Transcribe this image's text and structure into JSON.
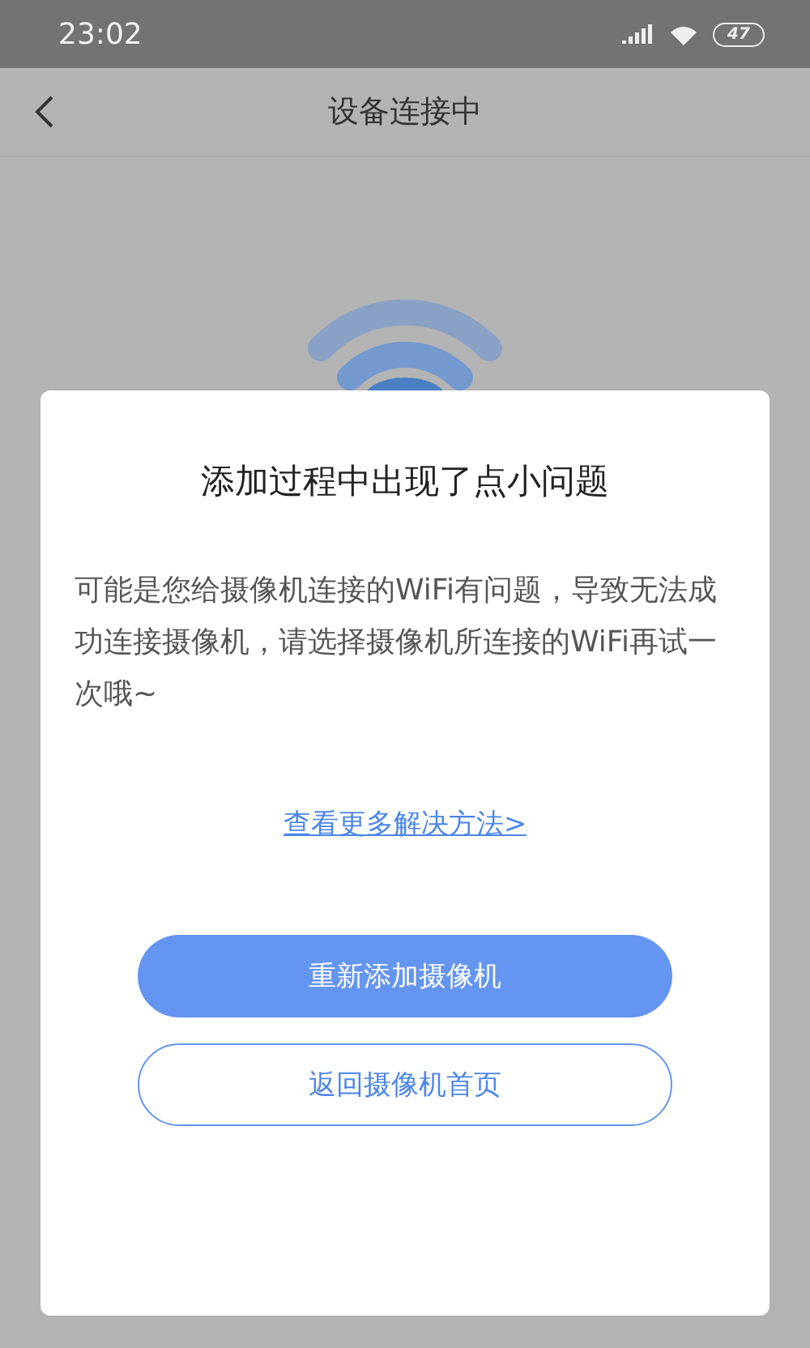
{
  "status_bar": {
    "time": "23:02",
    "battery": "47"
  },
  "nav": {
    "title": "设备连接中"
  },
  "dialog": {
    "title": "添加过程中出现了点小问题",
    "message": "可能是您给摄像机连接的WiFi有问题，导致无法成功连接摄像机，请选择摄像机所连接的WiFi再试一次哦~",
    "link": "查看更多解决方法>",
    "buttons": [
      {
        "label": "重新添加摄像机",
        "kind": "primary"
      },
      {
        "label": "返回摄像机首页",
        "kind": "outline"
      }
    ]
  }
}
